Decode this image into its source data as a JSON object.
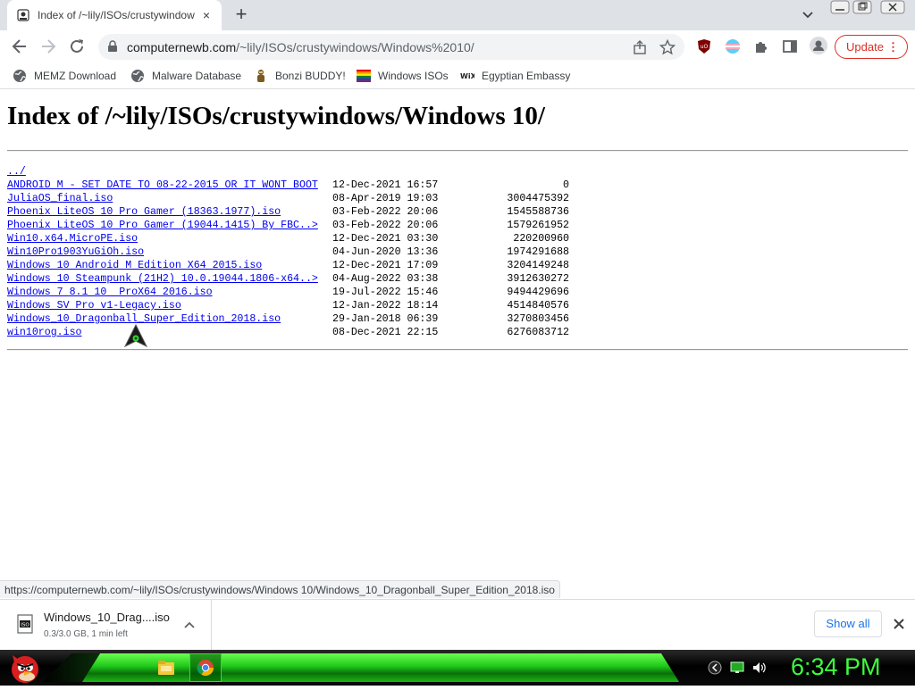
{
  "browser": {
    "tab": {
      "title": "Index of /~lily/ISOs/crustywindows/Window"
    },
    "address": {
      "host": "computernewb.com",
      "path": "/~lily/ISOs/crustywindows/Windows%2010/"
    },
    "update_label": "Update",
    "menu_label": "⋮"
  },
  "bookmarks": [
    {
      "label": "MEMZ Download",
      "icon": "globe-icon"
    },
    {
      "label": "Malware Database",
      "icon": "globe-icon"
    },
    {
      "label": "Bonzi BUDDY!",
      "icon": "bonzi-icon"
    },
    {
      "label": "Windows ISOs",
      "icon": "rainbow-flag-icon"
    },
    {
      "label": "Egyptian Embassy",
      "icon": "wix-icon"
    }
  ],
  "page": {
    "heading": "Index of /~lily/ISOs/crustywindows/Windows 10/",
    "parent_link": "../",
    "entries": [
      {
        "name": "ANDROID M - SET DATE TO 08-22-2015 OR IT WONT BOOT",
        "date": "12-Dec-2021 16:57",
        "size": "0"
      },
      {
        "name": "JuliaOS_final.iso",
        "date": "08-Apr-2019 19:03",
        "size": "3004475392"
      },
      {
        "name": "Phoenix LiteOS 10 Pro Gamer (18363.1977).iso",
        "date": "03-Feb-2022 20:06",
        "size": "1545588736"
      },
      {
        "name": "Phoenix LiteOS 10 Pro Gamer (19044.1415) By FBC..>",
        "date": "03-Feb-2022 20:06",
        "size": "1579261952"
      },
      {
        "name": "Win10.x64.MicroPE.iso",
        "date": "12-Dec-2021 03:30",
        "size": "220200960"
      },
      {
        "name": "Win10Pro1903YuGiOh.iso",
        "date": "04-Jun-2020 13:36",
        "size": "1974291688"
      },
      {
        "name": "Windows 10 Android M Edition X64 2015.iso",
        "date": "12-Dec-2021 17:09",
        "size": "3204149248"
      },
      {
        "name": "Windows 10 Steampunk (21H2) 10.0.19044.1806-x64..>",
        "date": "04-Aug-2022 03:38",
        "size": "3912630272"
      },
      {
        "name": "Windows 7 8.1 10  ProX64 2016.iso",
        "date": "19-Jul-2022 15:46",
        "size": "9494429696"
      },
      {
        "name": "Windows SV Pro v1-Legacy.iso",
        "date": "12-Jan-2022 18:14",
        "size": "4514840576"
      },
      {
        "name": "Windows_10_Dragonball_Super_Edition_2018.iso",
        "date": "29-Jan-2018 06:39",
        "size": "3270803456"
      },
      {
        "name": "win10rog.iso",
        "date": "08-Dec-2021 22:15",
        "size": "6276083712"
      }
    ]
  },
  "status_url": "https://computernewb.com/~lily/ISOs/crustywindows/Windows 10/Windows_10_Dragonball_Super_Edition_2018.iso",
  "download": {
    "filename": "Windows_10_Drag....iso",
    "progress": "0.3/3.0 GB, 1 min left",
    "show_all": "Show all"
  },
  "taskbar": {
    "clock": "6:34 PM"
  },
  "colors": {
    "link": "#0000ee",
    "update_red": "#d93025",
    "taskbar_green": "#1ec81a",
    "clock_green": "#3cff3c"
  }
}
